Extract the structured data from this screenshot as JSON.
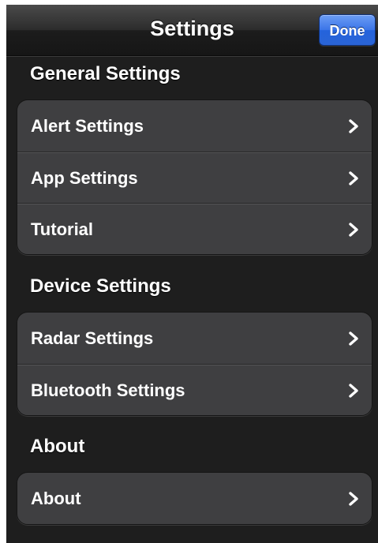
{
  "navbar": {
    "title": "Settings",
    "done_label": "Done"
  },
  "sections": [
    {
      "header": "General Settings",
      "items": [
        {
          "label": "Alert Settings"
        },
        {
          "label": "App Settings"
        },
        {
          "label": "Tutorial"
        }
      ]
    },
    {
      "header": "Device Settings",
      "items": [
        {
          "label": "Radar Settings"
        },
        {
          "label": "Bluetooth Settings"
        }
      ]
    },
    {
      "header": "About",
      "items": [
        {
          "label": "About"
        }
      ]
    }
  ],
  "colors": {
    "background": "#1e1e1e",
    "cell": "#3f3f41",
    "accent": "#2f6be0"
  },
  "icons": {
    "row_accessory": "chevron-right-icon"
  }
}
